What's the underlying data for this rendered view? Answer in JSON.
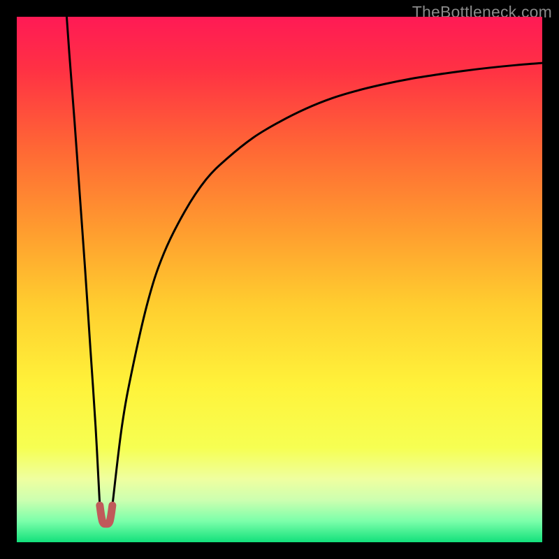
{
  "watermark": "TheBottleneck.com",
  "chart_data": {
    "type": "line",
    "title": "",
    "xlabel": "",
    "ylabel": "",
    "xlim": [
      0,
      100
    ],
    "ylim": [
      0,
      100
    ],
    "x_optimum": 17,
    "series": [
      {
        "name": "left-branch",
        "x": [
          9.5,
          10,
          11,
          12,
          13,
          14,
          15,
          15.8
        ],
        "values": [
          100,
          93,
          80,
          66,
          52,
          37,
          22,
          7
        ]
      },
      {
        "name": "right-branch",
        "x": [
          18.2,
          20,
          22,
          25,
          28,
          32,
          36,
          40,
          45,
          50,
          55,
          60,
          65,
          70,
          75,
          80,
          85,
          90,
          95,
          100
        ],
        "values": [
          7,
          22,
          33,
          46,
          55,
          63,
          69,
          73,
          77,
          80,
          82.5,
          84.5,
          86,
          87.2,
          88.2,
          89,
          89.7,
          90.3,
          90.8,
          91.2
        ]
      },
      {
        "name": "cup-marker",
        "x": [
          15.8,
          16.3,
          17,
          17.7,
          18.2
        ],
        "values": [
          7,
          4,
          3.5,
          4,
          7
        ]
      }
    ],
    "gradient_stops": [
      {
        "offset": 0.0,
        "color": "#ff1a55"
      },
      {
        "offset": 0.1,
        "color": "#ff3144"
      },
      {
        "offset": 0.25,
        "color": "#ff6735"
      },
      {
        "offset": 0.4,
        "color": "#ff9a2f"
      },
      {
        "offset": 0.55,
        "color": "#ffce2f"
      },
      {
        "offset": 0.7,
        "color": "#fff23a"
      },
      {
        "offset": 0.82,
        "color": "#f6ff52"
      },
      {
        "offset": 0.88,
        "color": "#efffa0"
      },
      {
        "offset": 0.92,
        "color": "#ccffb0"
      },
      {
        "offset": 0.96,
        "color": "#7bffaa"
      },
      {
        "offset": 1.0,
        "color": "#12e07b"
      }
    ],
    "colors": {
      "curve": "#000000",
      "cup": "#c05a5a"
    }
  }
}
